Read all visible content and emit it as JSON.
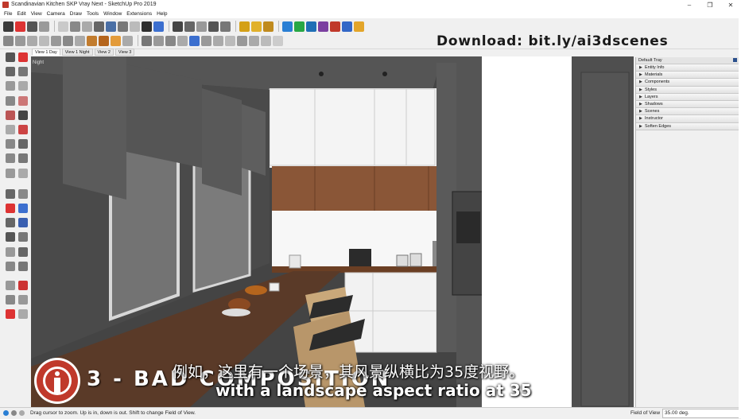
{
  "window": {
    "title": "Scandinavian Kitchen SKP Vray Next - SketchUp Pro 2019",
    "controls": [
      "–",
      "❐",
      "✕"
    ]
  },
  "menu": [
    "File",
    "Edit",
    "View",
    "Camera",
    "Draw",
    "Tools",
    "Window",
    "Extensions",
    "Help"
  ],
  "overlay": {
    "download": "Download: bit.ly/ai3dscenes",
    "heading": "3 - BAD COMPOSITION",
    "subtitle_cn": "例如，这里有一个场景，其风景纵横比为35度视野。",
    "subtitle_en": "with a landscape aspect ratio at 35"
  },
  "scene_tabs": [
    {
      "label": "View 1 Day",
      "active": true
    },
    {
      "label": "View 1 Night",
      "active": false
    },
    {
      "label": "View 2",
      "active": false
    },
    {
      "label": "View 3",
      "active": false
    }
  ],
  "viewport": {
    "scene_label": "Night"
  },
  "tray": {
    "title": "Default Tray",
    "panels": [
      "Entity Info",
      "Materials",
      "Components",
      "Styles",
      "Layers",
      "Shadows",
      "Scenes",
      "Instructor",
      "Soften Edges"
    ]
  },
  "status": {
    "message": "Drag cursor to zoom.  Up is in, down is out. Shift to change Field of View.",
    "field_label": "Field of View",
    "field_value": "35.00 deg."
  },
  "colors": {
    "accent": "#c0392b",
    "wood": "#8a5637",
    "wall_dark": "#4a4a4a",
    "cabinet_white": "#f4f4f4"
  }
}
